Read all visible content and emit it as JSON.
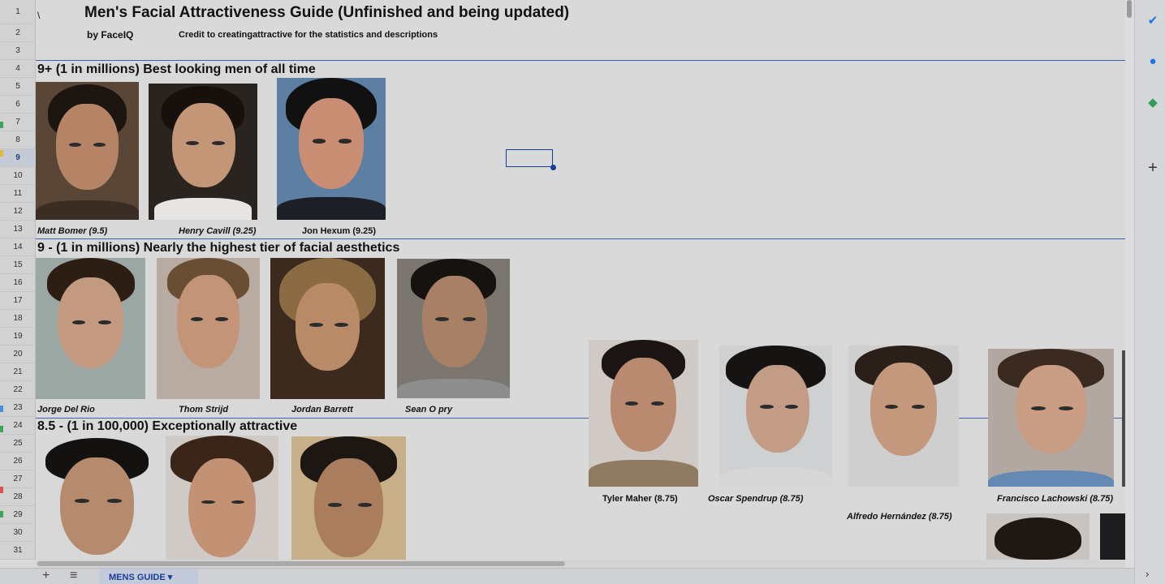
{
  "sheet": {
    "title": "Men's Facial Attractiveness Guide (Unfinished and being updated)",
    "cell_a1": "\\",
    "by": "by FaceIQ",
    "credit": "Credit to creatingattractive for the statistics and descriptions",
    "row_numbers": [
      "1",
      "2",
      "3",
      "4",
      "5",
      "6",
      "7",
      "8",
      "9",
      "10",
      "11",
      "12",
      "13",
      "14",
      "15",
      "16",
      "17",
      "18",
      "19",
      "20",
      "21",
      "22",
      "23",
      "24",
      "25",
      "26",
      "27",
      "28",
      "29",
      "30",
      "31"
    ],
    "selected_row": "9"
  },
  "sections": [
    {
      "heading": "9+ (1 in millions) Best looking men of all time"
    },
    {
      "heading": "9 - (1 in millions) Nearly the highest tier of facial aesthetics"
    },
    {
      "heading": "8.5 - (1 in 100,000) Exceptionally attractive"
    }
  ],
  "captions": {
    "matt": "Matt Bomer (9.5)",
    "henry": "Henry Cavill (9.25)",
    "jon": "Jon Hexum (9.25)",
    "jorge": "Jorge Del Rio",
    "thom": "Thom Strijd",
    "jordan": "Jordan Barrett",
    "sean": "Sean O pry",
    "tyler": "Tyler Maher (8.75)",
    "oscar": "Oscar Spendrup (8.75)",
    "alfredo": "Alfredo Hernández (8.75)",
    "francisco": "Francisco Lachowski (8.75)"
  },
  "tabs": {
    "add_label": "+",
    "menu_label": "≡",
    "active_sheet": "MENS GUIDE ▾"
  },
  "rail": {
    "tasks_icon": "✔",
    "contacts_icon": "●",
    "maps_icon": "◆",
    "add_icon": "+",
    "collapse_icon": "›"
  },
  "colors": {
    "accent": "#1a3d9c",
    "divider": "#3f63a8"
  }
}
